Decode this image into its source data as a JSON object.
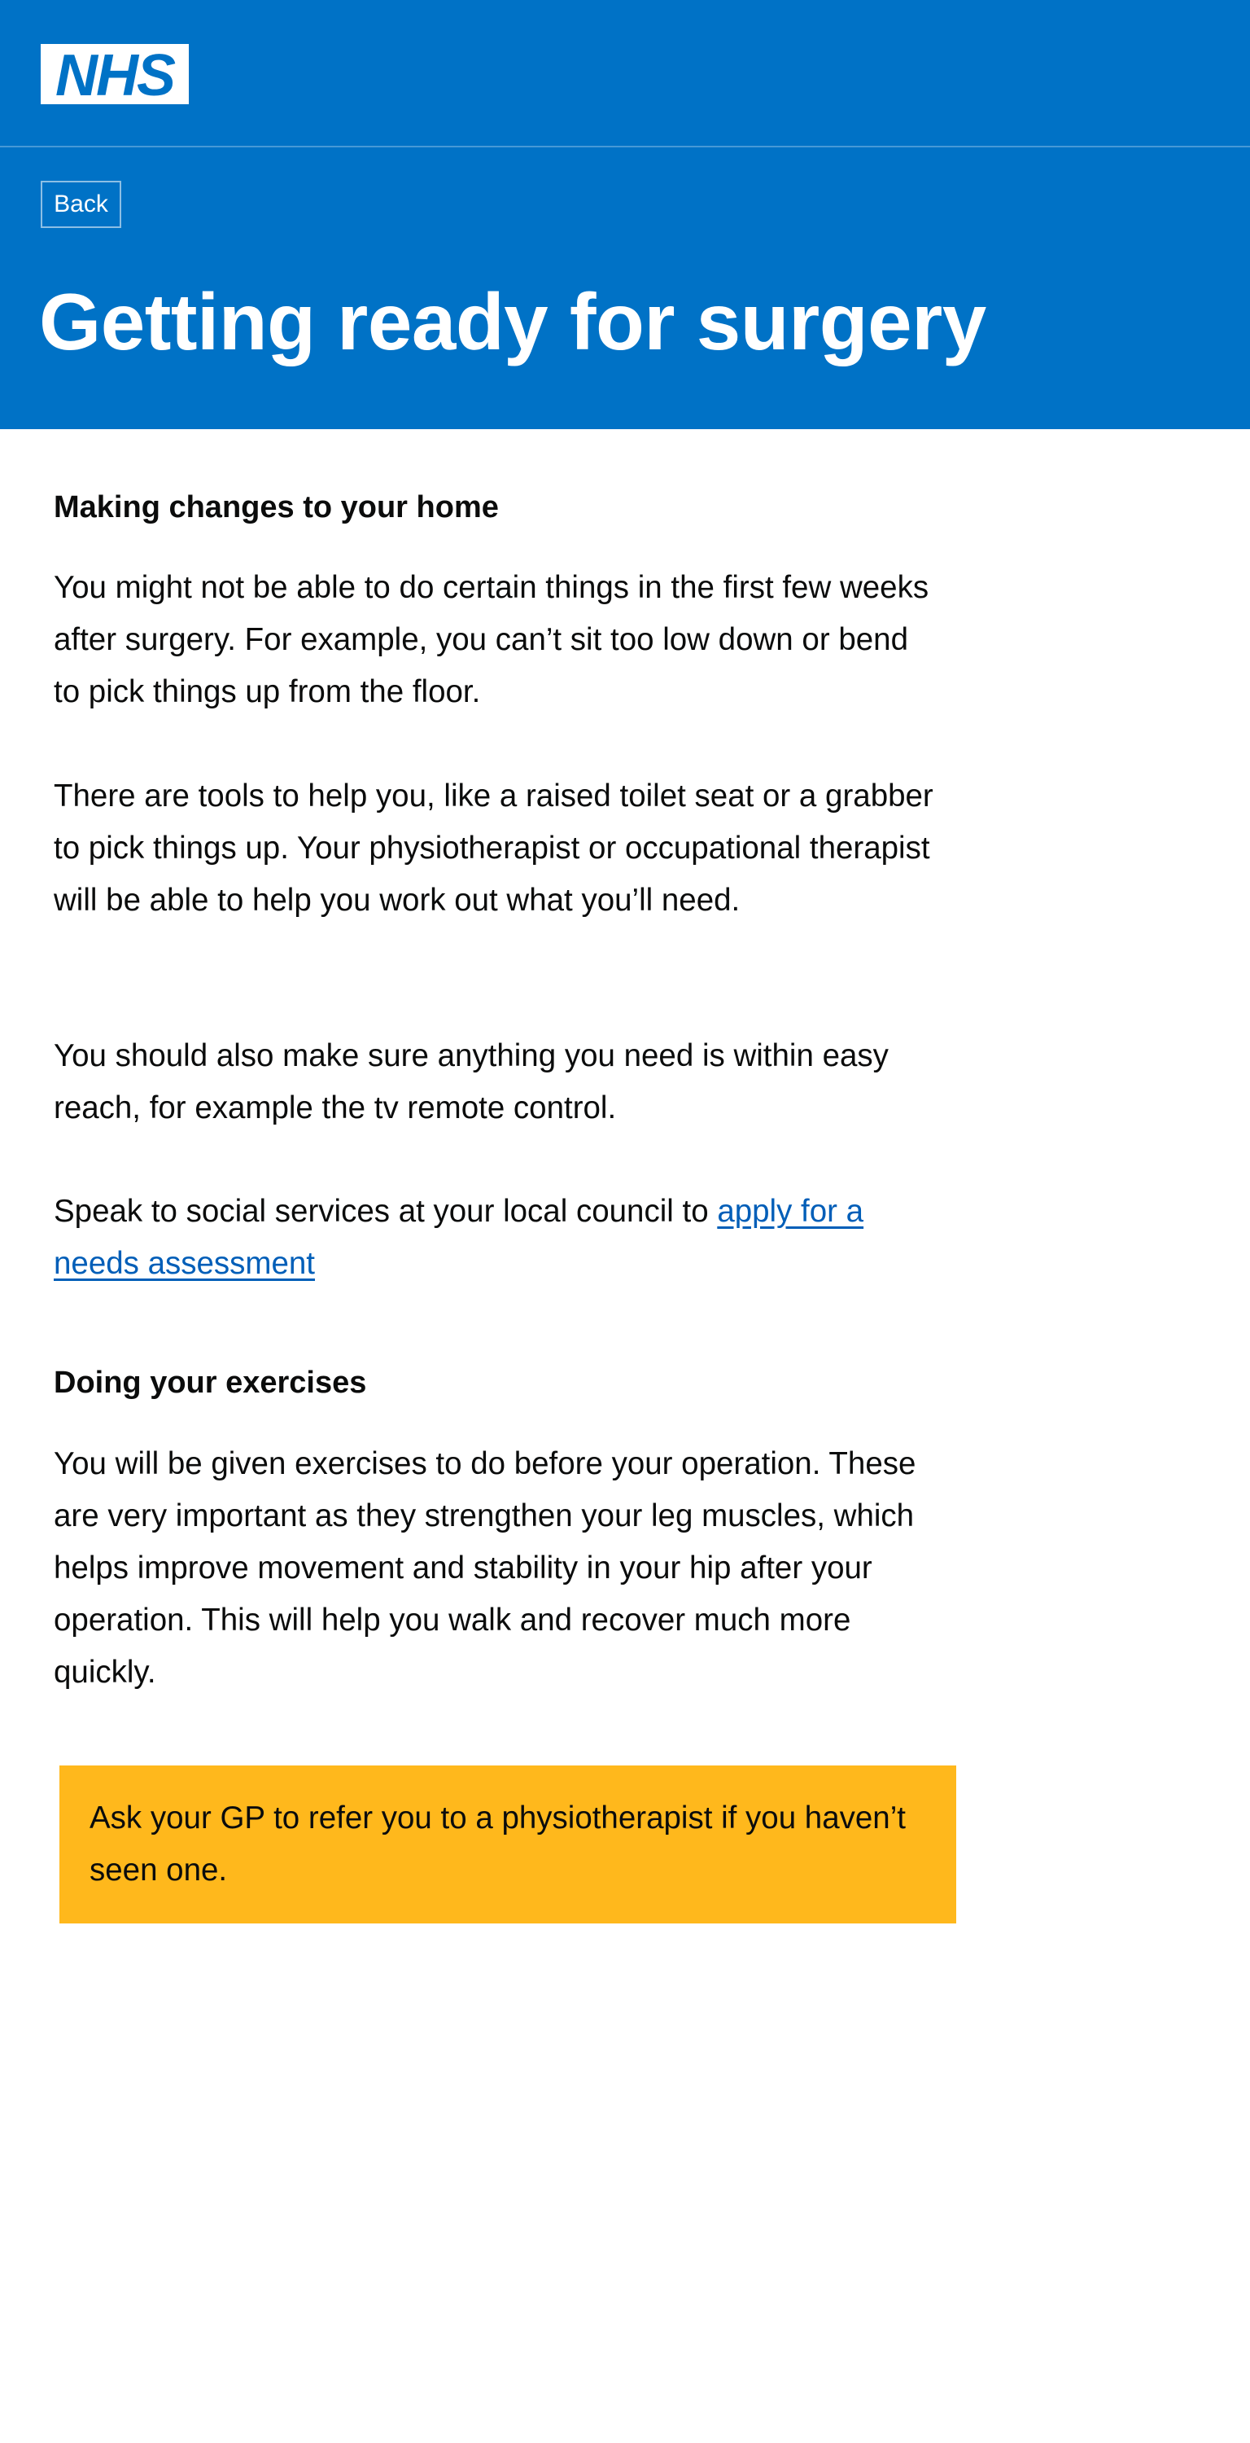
{
  "header": {
    "logo_text": "NHS",
    "back_label": "Back",
    "title": "Getting ready for surgery"
  },
  "sections": [
    {
      "heading": "Making changes to your home",
      "paragraphs": [
        "You might not be able to do certain things in the first few weeks after surgery. For example, you can’t sit too low down or bend to pick things up from the floor.",
        "There are tools to help you, like a raised toilet seat or a grabber to pick things up. Your physiotherapist or occupational therapist will be able to help you work out what you’ll need.",
        "You should also make sure anything you need is within easy reach, for example the tv remote control."
      ],
      "link_paragraph": {
        "text": "Speak to social services at your local council to ",
        "link_text": "apply for a needs assessment"
      }
    },
    {
      "heading": "Doing your exercises",
      "paragraphs": [
        "You will be given exercises to do before your operation. These are very important as they strengthen your leg muscles, which helps improve movement and stability in your hip after your operation.  This will help you walk and recover much more quickly."
      ]
    }
  ],
  "callout": {
    "text": "Ask your GP to refer you to a physiotherapist if you haven’t seen one."
  },
  "colors": {
    "header_blue": "#0072c6",
    "link_blue": "#005eb8",
    "callout_yellow": "#ffb81c",
    "text": "#0b0c0c"
  }
}
